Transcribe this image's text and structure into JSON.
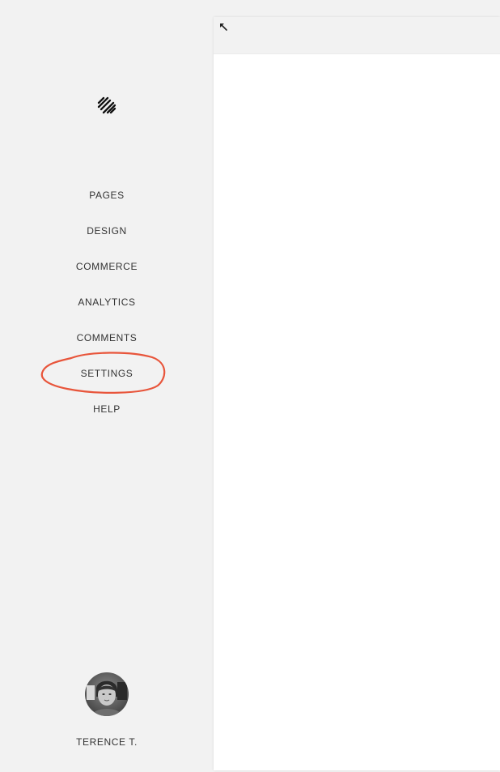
{
  "sidebar": {
    "logo_icon": "squarespace-logo-icon",
    "nav_items": [
      {
        "label": "PAGES"
      },
      {
        "label": "DESIGN"
      },
      {
        "label": "COMMERCE"
      },
      {
        "label": "ANALYTICS"
      },
      {
        "label": "COMMENTS"
      },
      {
        "label": "SETTINGS",
        "highlighted": true
      },
      {
        "label": "HELP"
      }
    ],
    "user": {
      "name": "TERENCE T.",
      "avatar_icon": "user-avatar"
    }
  },
  "panel": {
    "expand_icon": "arrow-up-left-icon"
  },
  "colors": {
    "sidebar_bg": "#f2f2f2",
    "text": "#333333",
    "annotation": "#e8553b",
    "panel_bg": "#ffffff"
  }
}
